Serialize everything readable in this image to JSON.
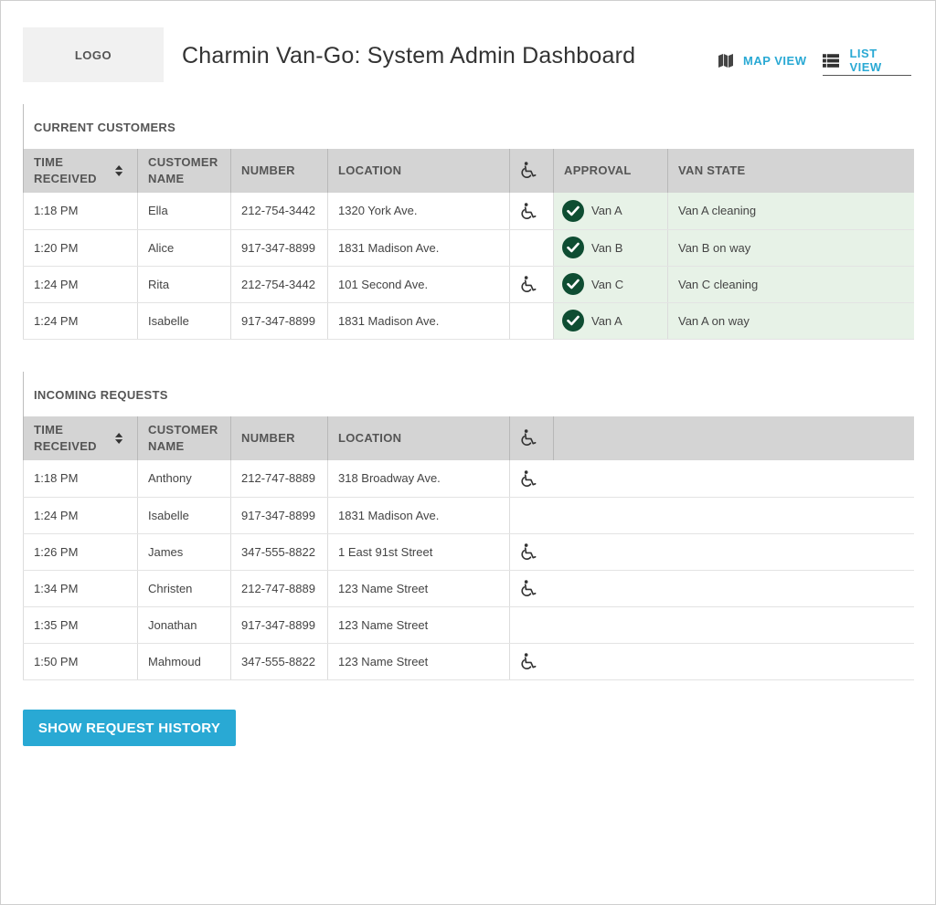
{
  "header": {
    "logo": "LOGO",
    "title": "Charmin Van-Go: System Admin Dashboard",
    "map_view": "MAP VIEW",
    "list_view": "LIST VIEW"
  },
  "current": {
    "title": "CURRENT CUSTOMERS",
    "columns": {
      "time": "TIME RECEIVED",
      "name": "CUSTOMER NAME",
      "number": "NUMBER",
      "location": "LOCATION",
      "approval": "APPROVAL",
      "van_state": "VAN STATE"
    },
    "rows": [
      {
        "time": "1:18 PM",
        "name": "Ella",
        "number": "212-754-3442",
        "location": "1320 York Ave.",
        "accessible": true,
        "approval": "Van A",
        "van_state": "Van A cleaning"
      },
      {
        "time": "1:20 PM",
        "name": "Alice",
        "number": "917-347-8899",
        "location": "1831 Madison Ave.",
        "accessible": false,
        "approval": "Van B",
        "van_state": "Van B on way"
      },
      {
        "time": "1:24 PM",
        "name": "Rita",
        "number": "212-754-3442",
        "location": "101 Second Ave.",
        "accessible": true,
        "approval": "Van C",
        "van_state": "Van C cleaning"
      },
      {
        "time": "1:24 PM",
        "name": "Isabelle",
        "number": "917-347-8899",
        "location": "1831 Madison Ave.",
        "accessible": false,
        "approval": "Van A",
        "van_state": "Van A on way"
      }
    ]
  },
  "incoming": {
    "title": "INCOMING REQUESTS",
    "columns": {
      "time": "TIME RECEIVED",
      "name": "CUSTOMER NAME",
      "number": "NUMBER",
      "location": "LOCATION"
    },
    "rows": [
      {
        "time": "1:18 PM",
        "name": "Anthony",
        "number": "212-747-8889",
        "location": "318 Broadway Ave.",
        "accessible": true
      },
      {
        "time": "1:24 PM",
        "name": "Isabelle",
        "number": "917-347-8899",
        "location": "1831 Madison Ave.",
        "accessible": false
      },
      {
        "time": "1:26 PM",
        "name": "James",
        "number": "347-555-8822",
        "location": "1 East 91st Street",
        "accessible": true
      },
      {
        "time": "1:34 PM",
        "name": "Christen",
        "number": "212-747-8889",
        "location": "123 Name Street",
        "accessible": true
      },
      {
        "time": "1:35 PM",
        "name": "Jonathan",
        "number": "917-347-8899",
        "location": "123 Name Street",
        "accessible": false
      },
      {
        "time": "1:50 PM",
        "name": "Mahmoud",
        "number": "347-555-8822",
        "location": "123 Name Street",
        "accessible": true
      }
    ]
  },
  "actions": {
    "show_history": "SHOW REQUEST HISTORY"
  },
  "colors": {
    "accent": "#29a9d4",
    "approved_bg": "#e7f2e7",
    "check": "#0e4d32",
    "header_bg": "#d4d4d4"
  },
  "icons": {
    "map": "map-icon",
    "list": "list-icon",
    "wheelchair": "wheelchair-icon",
    "check": "check-circle-icon",
    "sort": "sort-icon"
  }
}
